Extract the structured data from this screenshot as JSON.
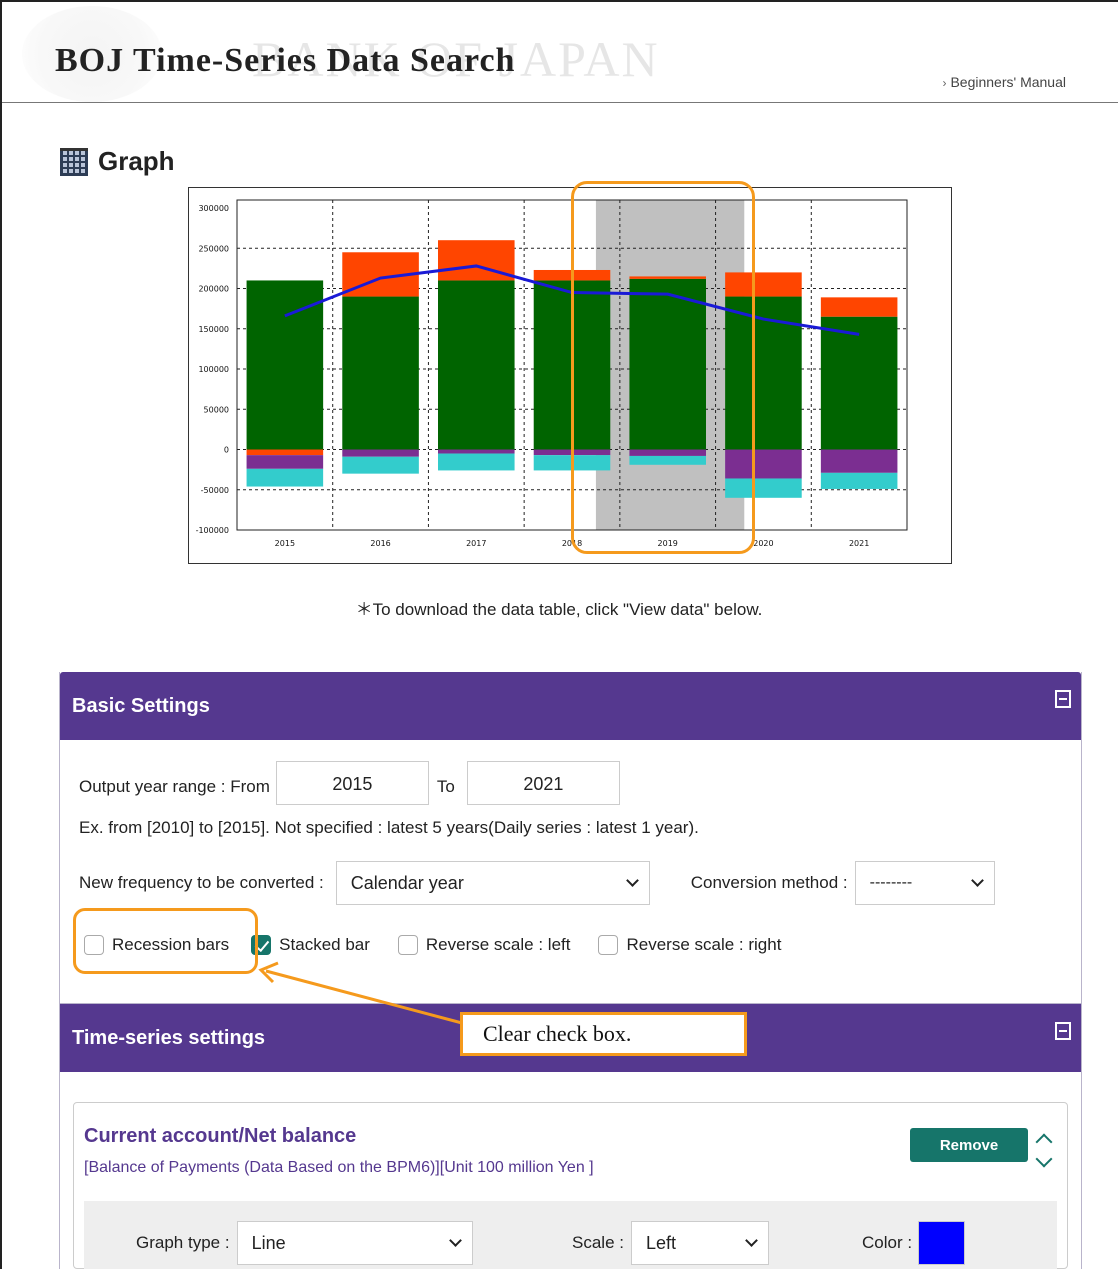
{
  "header": {
    "title": "BOJ Time-Series Data Search",
    "watermark": "BANK OF JAPAN",
    "manual_link": "Beginners' Manual"
  },
  "graph": {
    "heading": "Graph",
    "download_note": "＊To download the data table, click \"View data\" below."
  },
  "chart_data": {
    "type": "bar",
    "stacked": true,
    "categories": [
      "2015",
      "2016",
      "2017",
      "2018",
      "2019",
      "2020",
      "2021"
    ],
    "ylim": [
      -100000,
      300000
    ],
    "y_ticks": [
      "300000",
      "250000",
      "200000",
      "150000",
      "100000",
      "50000",
      "0",
      "-50000",
      "-100000"
    ],
    "grid": true,
    "recession_shading": [
      "2019"
    ],
    "series": [
      {
        "color": "#006400",
        "values": [
          210000,
          190000,
          210000,
          210000,
          212000,
          190000,
          165000
        ]
      },
      {
        "color": "#ff4500",
        "values": [
          -7000,
          55000,
          50000,
          13000,
          3000,
          30000,
          24000
        ]
      },
      {
        "color": "#7b2e91",
        "values": [
          -17000,
          -9000,
          -5000,
          -7000,
          -8000,
          -36000,
          -29000
        ]
      },
      {
        "color": "#33cccc",
        "values": [
          -22000,
          -21000,
          -21000,
          -19000,
          -11000,
          -24000,
          -20000
        ]
      }
    ],
    "line": {
      "color": "#1a1ad6",
      "values": [
        166000,
        213000,
        228000,
        195000,
        193000,
        162000,
        143000
      ]
    }
  },
  "basic_settings": {
    "title": "Basic Settings",
    "year_range_label": "Output year range : From",
    "from_value": "2015",
    "to_label": "To",
    "to_value": "2021",
    "example_text": "Ex. from [2010] to [2015]. Not specified : latest 5 years(Daily series : latest 1 year).",
    "frequency_label": "New frequency to be converted :",
    "frequency_value": "Calendar year",
    "conversion_label": "Conversion method :",
    "conversion_value": "--------",
    "recession_bars": "Recession bars",
    "stacked_bar": "Stacked bar",
    "reverse_left": "Reverse scale : left",
    "reverse_right": "Reverse scale : right"
  },
  "time_series": {
    "title": "Time-series settings",
    "series_name": "Current account/Net balance",
    "series_desc": "[Balance of Payments (Data Based on the BPM6)][Unit 100 million Yen ]",
    "remove_label": "Remove",
    "graph_type_label": "Graph type :",
    "graph_type_value": "Line",
    "scale_label": "Scale :",
    "scale_value": "Left",
    "color_label": "Color :",
    "color_value": "#0000ff"
  },
  "annotation": {
    "callout": "Clear check box.",
    "accent_color": "#f59a1d"
  }
}
